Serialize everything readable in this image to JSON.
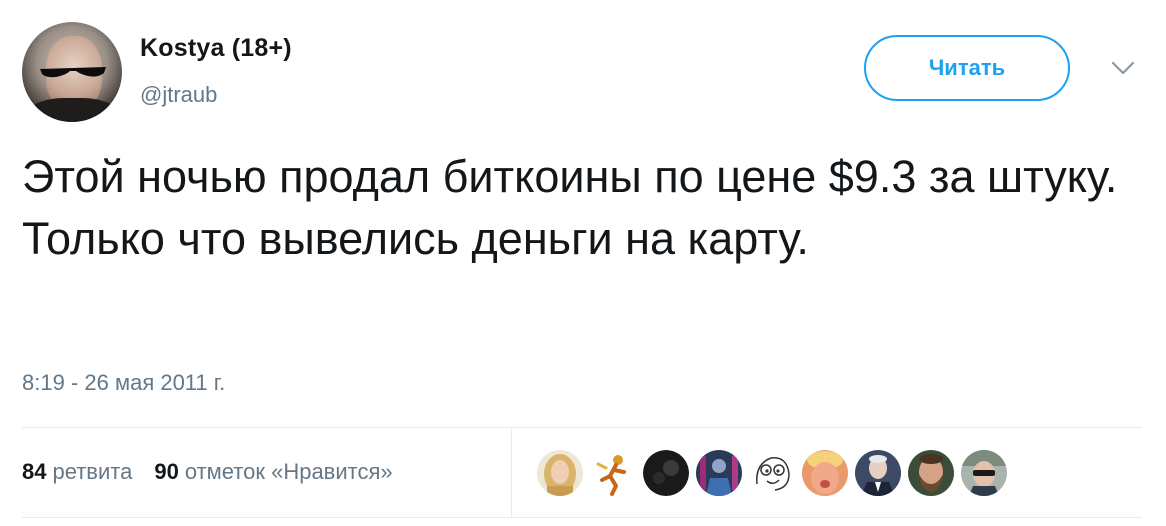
{
  "user": {
    "display_name": "Kostya (18+)",
    "handle": "@jtraub",
    "avatar_icon": "user-avatar-photo"
  },
  "follow_button": {
    "label": "Читать",
    "color": "#1da1f2"
  },
  "menu": {
    "icon": "chevron-down-icon"
  },
  "tweet": {
    "text": "Этой ночью продал биткоины по цене $9.3 за штуку. Только что вывелись деньги на карту.",
    "timestamp": "8:19 - 26 мая 2011 г."
  },
  "stats": {
    "retweets_count": "84",
    "retweets_label": "ретвита",
    "likes_count": "90",
    "likes_label": "отметок «Нравится»"
  },
  "likers": [
    {
      "icon": "liker-avatar-blonde-woman"
    },
    {
      "icon": "liker-avatar-running-figure"
    },
    {
      "icon": "liker-avatar-dark-circle"
    },
    {
      "icon": "liker-avatar-blue-figure"
    },
    {
      "icon": "liker-avatar-meme-face"
    },
    {
      "icon": "liker-avatar-orange-face"
    },
    {
      "icon": "liker-avatar-man-suit"
    },
    {
      "icon": "liker-avatar-bearded-man"
    },
    {
      "icon": "liker-avatar-man-sunglasses"
    }
  ]
}
